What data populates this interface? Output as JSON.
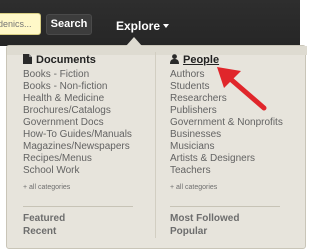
{
  "topbar": {
    "search_placeholder": "denics...",
    "search_button": "Search",
    "explore_label": "Explore"
  },
  "menu": {
    "documents": {
      "header": "Documents",
      "icon": "document-icon",
      "items": [
        "Books - Fiction",
        "Books - Non-fiction",
        "Health & Medicine",
        "Brochures/Catalogs",
        "Government Docs",
        "How-To Guides/Manuals",
        "Magazines/Newspapers",
        "Recipes/Menus",
        "School Work"
      ],
      "all_categories": "+ all categories",
      "footer": [
        "Featured",
        "Recent"
      ]
    },
    "people": {
      "header": "People",
      "icon": "person-icon",
      "items": [
        "Authors",
        "Students",
        "Researchers",
        "Publishers",
        "Government & Nonprofits",
        "Businesses",
        "Musicians",
        "Artists & Designers",
        "Teachers"
      ],
      "all_categories": "+ all categories",
      "footer": [
        "Most Followed",
        "Popular"
      ]
    }
  },
  "annotation": {
    "arrow_color": "#e0262b"
  }
}
